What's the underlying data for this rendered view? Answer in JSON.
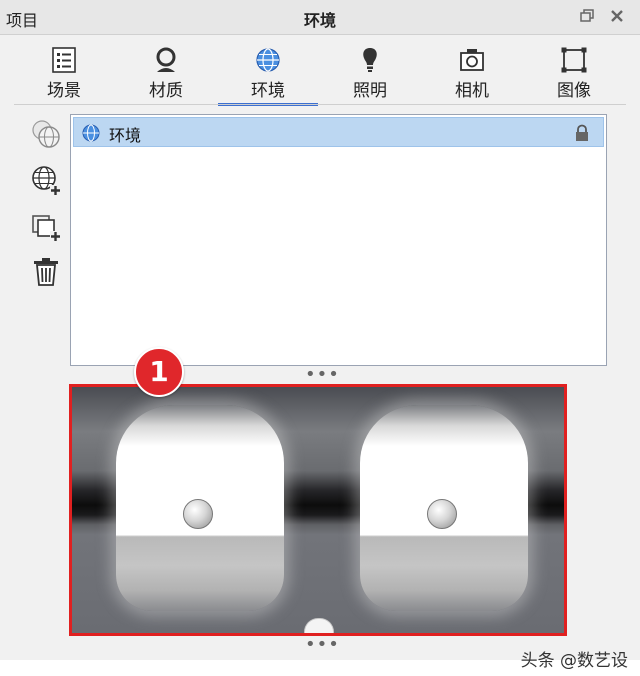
{
  "window": {
    "left_title": "项目",
    "center_title": "环境"
  },
  "tabs": [
    {
      "label": "场景",
      "icon": "list-icon"
    },
    {
      "label": "材质",
      "icon": "material-ball-icon"
    },
    {
      "label": "环境",
      "icon": "globe-icon",
      "active": true
    },
    {
      "label": "照明",
      "icon": "light-bulb-icon"
    },
    {
      "label": "相机",
      "icon": "camera-icon"
    },
    {
      "label": "图像",
      "icon": "image-frame-icon"
    }
  ],
  "tools": [
    "duplicate-environment-icon",
    "add-environment-icon",
    "import-environment-icon",
    "trash-icon"
  ],
  "list": {
    "items": [
      {
        "label": "环境",
        "icon": "globe-icon",
        "locked": true
      }
    ]
  },
  "callout": {
    "number": "1"
  },
  "watermark": "头条 @数艺设",
  "colors": {
    "accent": "#3b6fd0",
    "selection": "#bcd7f2",
    "highlight_border": "#e02020",
    "callout": "#e0272b"
  }
}
